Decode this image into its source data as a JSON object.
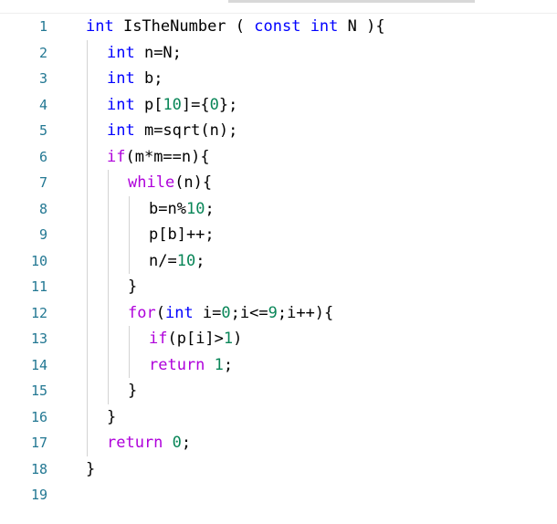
{
  "editor": {
    "colors": {
      "line_number": "#237893",
      "keyword": "#0000ff",
      "control": "#af00db",
      "number": "#098658",
      "text": "#000000",
      "indent_guide": "#d3d3d3"
    },
    "line_numbers": [
      "1",
      "2",
      "3",
      "4",
      "5",
      "6",
      "7",
      "8",
      "9",
      "10",
      "11",
      "12",
      "13",
      "14",
      "15",
      "16",
      "17",
      "18",
      "19"
    ],
    "lines": [
      {
        "indent": 0,
        "tokens": [
          {
            "t": "int",
            "c": "keyword"
          },
          {
            "t": " IsTheNumber ( ",
            "c": "plain"
          },
          {
            "t": "const",
            "c": "keyword"
          },
          {
            "t": " ",
            "c": "plain"
          },
          {
            "t": "int",
            "c": "keyword"
          },
          {
            "t": " N ){",
            "c": "plain"
          }
        ]
      },
      {
        "indent": 1,
        "tokens": [
          {
            "t": "int",
            "c": "keyword"
          },
          {
            "t": " n=N;",
            "c": "plain"
          }
        ]
      },
      {
        "indent": 1,
        "tokens": [
          {
            "t": "int",
            "c": "keyword"
          },
          {
            "t": " b;",
            "c": "plain"
          }
        ]
      },
      {
        "indent": 1,
        "tokens": [
          {
            "t": "int",
            "c": "keyword"
          },
          {
            "t": " p[",
            "c": "plain"
          },
          {
            "t": "10",
            "c": "number"
          },
          {
            "t": "]={",
            "c": "plain"
          },
          {
            "t": "0",
            "c": "number"
          },
          {
            "t": "};",
            "c": "plain"
          }
        ]
      },
      {
        "indent": 1,
        "tokens": [
          {
            "t": "int",
            "c": "keyword"
          },
          {
            "t": " m=sqrt(n);",
            "c": "plain"
          }
        ]
      },
      {
        "indent": 1,
        "tokens": [
          {
            "t": "if",
            "c": "control"
          },
          {
            "t": "(m*m==n){",
            "c": "plain"
          }
        ]
      },
      {
        "indent": 2,
        "tokens": [
          {
            "t": "while",
            "c": "control"
          },
          {
            "t": "(n){",
            "c": "plain"
          }
        ]
      },
      {
        "indent": 3,
        "tokens": [
          {
            "t": "b=n%",
            "c": "plain"
          },
          {
            "t": "10",
            "c": "number"
          },
          {
            "t": ";",
            "c": "plain"
          }
        ]
      },
      {
        "indent": 3,
        "tokens": [
          {
            "t": "p[b]++;",
            "c": "plain"
          }
        ]
      },
      {
        "indent": 3,
        "tokens": [
          {
            "t": "n/=",
            "c": "plain"
          },
          {
            "t": "10",
            "c": "number"
          },
          {
            "t": ";",
            "c": "plain"
          }
        ]
      },
      {
        "indent": 2,
        "tokens": [
          {
            "t": "}",
            "c": "plain"
          }
        ]
      },
      {
        "indent": 2,
        "tokens": [
          {
            "t": "for",
            "c": "control"
          },
          {
            "t": "(",
            "c": "plain"
          },
          {
            "t": "int",
            "c": "keyword"
          },
          {
            "t": " i=",
            "c": "plain"
          },
          {
            "t": "0",
            "c": "number"
          },
          {
            "t": ";i<=",
            "c": "plain"
          },
          {
            "t": "9",
            "c": "number"
          },
          {
            "t": ";i++){",
            "c": "plain"
          }
        ]
      },
      {
        "indent": 3,
        "tokens": [
          {
            "t": "if",
            "c": "control"
          },
          {
            "t": "(p[i]>",
            "c": "plain"
          },
          {
            "t": "1",
            "c": "number"
          },
          {
            "t": ")",
            "c": "plain"
          }
        ]
      },
      {
        "indent": 3,
        "tokens": [
          {
            "t": "return",
            "c": "control"
          },
          {
            "t": " ",
            "c": "plain"
          },
          {
            "t": "1",
            "c": "number"
          },
          {
            "t": ";",
            "c": "plain"
          }
        ]
      },
      {
        "indent": 2,
        "tokens": [
          {
            "t": "}",
            "c": "plain"
          }
        ]
      },
      {
        "indent": 1,
        "tokens": [
          {
            "t": "}",
            "c": "plain"
          }
        ]
      },
      {
        "indent": 1,
        "tokens": [
          {
            "t": "return",
            "c": "control"
          },
          {
            "t": " ",
            "c": "plain"
          },
          {
            "t": "0",
            "c": "number"
          },
          {
            "t": ";",
            "c": "plain"
          }
        ]
      },
      {
        "indent": 0,
        "tokens": [
          {
            "t": "}",
            "c": "plain"
          }
        ]
      },
      {
        "indent": 0,
        "tokens": []
      }
    ]
  }
}
